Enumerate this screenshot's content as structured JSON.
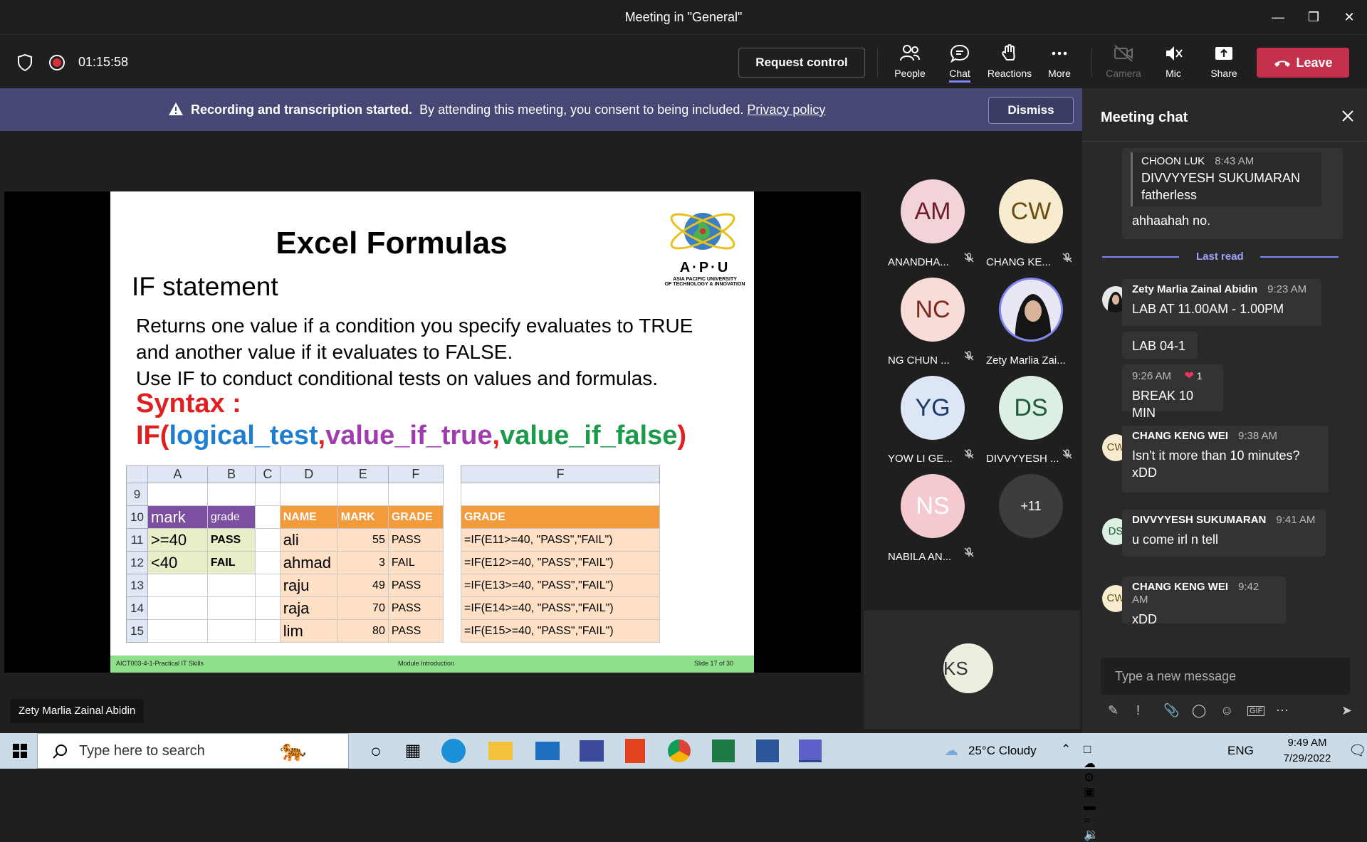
{
  "window": {
    "title": "Meeting in \"General\""
  },
  "toolbar": {
    "timer": "01:15:58",
    "request_control": "Request control",
    "people": "People",
    "chat": "Chat",
    "reactions": "Reactions",
    "more": "More",
    "camera": "Camera",
    "mic": "Mic",
    "share": "Share",
    "leave": "Leave"
  },
  "banner": {
    "bold": "Recording and transcription started.",
    "text": "By attending this meeting, you consent to being included.",
    "link": "Privacy policy",
    "dismiss": "Dismiss"
  },
  "slide": {
    "title": "Excel Formulas",
    "subtitle": "IF statement",
    "body": [
      "Returns one value if a condition you specify evaluates to TRUE",
      "and another value if it evaluates to FALSE.",
      "Use IF to conduct conditional tests on values and formulas."
    ],
    "syntax": "Syntax :",
    "if_prefix": "IF(",
    "if_logical": "logical_test",
    "if_comma1": ",",
    "if_true": "value_if_true",
    "if_comma2": ",",
    "if_false": "value_if_false",
    "if_close": ")",
    "logo_text": "A·P·U",
    "logo_sub1": "ASIA PACIFIC UNIVERSITY",
    "logo_sub2": "OF TECHNOLOGY & INNOVATION",
    "footer_left": "AICT003-4-1-Practical IT Skills",
    "footer_mid": "Module Introduction",
    "footer_right": "Slide 17 of 30",
    "grid_cols": [
      "A",
      "B",
      "C",
      "D",
      "E",
      "F"
    ],
    "grid_rows": [
      {
        "n": "9",
        "a": "",
        "b": "",
        "d": "",
        "e": "",
        "f": ""
      },
      {
        "n": "10",
        "a": "mark",
        "b": "grade",
        "d": "NAME",
        "e": "MARK",
        "f": "GRADE"
      },
      {
        "n": "11",
        "a": ">=40",
        "b": "PASS",
        "d": "ali",
        "e": "55",
        "f": "PASS"
      },
      {
        "n": "12",
        "a": "<40",
        "b": "FAIL",
        "d": "ahmad",
        "e": "3",
        "f": "FAIL"
      },
      {
        "n": "13",
        "a": "",
        "b": "",
        "d": "raju",
        "e": "49",
        "f": "PASS"
      },
      {
        "n": "14",
        "a": "",
        "b": "",
        "d": "raja",
        "e": "70",
        "f": "PASS"
      },
      {
        "n": "15",
        "a": "",
        "b": "",
        "d": "lim",
        "e": "80",
        "f": "PASS"
      }
    ],
    "grid2_header": "F",
    "grid2_rows": [
      "",
      "GRADE",
      "=IF(E11>=40, \"PASS\",\"FAIL\")",
      "=IF(E12>=40, \"PASS\",\"FAIL\")",
      "=IF(E13>=40, \"PASS\",\"FAIL\")",
      "=IF(E14>=40, \"PASS\",\"FAIL\")",
      "=IF(E15>=40, \"PASS\",\"FAIL\")"
    ]
  },
  "participants": [
    {
      "initials": "AM",
      "name": "ANANDHA...",
      "bg": "#f2d4d8",
      "fg": "#6b1d2a"
    },
    {
      "initials": "CW",
      "name": "CHANG KE...",
      "bg": "#f7ecd0",
      "fg": "#6b4d10"
    },
    {
      "initials": "NC",
      "name": "NG CHUN ...",
      "bg": "#f7dcd7",
      "fg": "#7a2a1e"
    },
    {
      "initials": "",
      "name": "Zety Marlia Zai...",
      "bg": "#d8d8f0",
      "fg": "#333"
    },
    {
      "initials": "YG",
      "name": "YOW LI GE...",
      "bg": "#dce6f5",
      "fg": "#1d3b6b"
    },
    {
      "initials": "DS",
      "name": "DIVVYYESH ...",
      "bg": "#dcefe2",
      "fg": "#1d5b35"
    },
    {
      "initials": "NS",
      "name": "NABILA AN...",
      "bg": "#f5c9d0",
      "fg": "#fff"
    },
    {
      "initials": "+11",
      "name": "",
      "bg": "#3d3d3d",
      "fg": "#fff"
    }
  ],
  "ks": {
    "initials": "KS"
  },
  "presenter": "Zety Marlia Zainal Abidin",
  "chat": {
    "title": "Meeting chat",
    "quote_name": "CHOON LUK",
    "quote_time": "8:43 AM",
    "quote_text1": "DIVVYYESH SUKUMARAN",
    "quote_text2": "fatherless",
    "reply": "ahhaahah no.",
    "last_read": "Last read",
    "messages": [
      {
        "name": "Zety Marlia Zainal Abidin",
        "time": "9:23 AM",
        "text": "LAB AT 11.00AM - 1.00PM"
      },
      {
        "text": "LAB 04-1"
      },
      {
        "time": "9:26 AM",
        "reaction": "1",
        "text": "BREAK 10 MIN"
      },
      {
        "initials": "CW",
        "name": "CHANG KENG WEI",
        "time": "9:38 AM",
        "text1": "Isn't it more than 10 minutes?",
        "text2": "xDD"
      },
      {
        "initials": "DS",
        "name": "DIVVYYESH SUKUMARAN",
        "time": "9:41 AM",
        "text": "u come irl n tell"
      },
      {
        "initials": "CW",
        "name": "CHANG KENG WEI",
        "time": "9:42 AM",
        "text": "xDD"
      }
    ],
    "compose_placeholder": "Type a new message"
  },
  "taskbar": {
    "search_placeholder": "Type here to search",
    "weather": "25°C  Cloudy",
    "lang": "ENG",
    "time": "9:49 AM",
    "date": "7/29/2022"
  }
}
